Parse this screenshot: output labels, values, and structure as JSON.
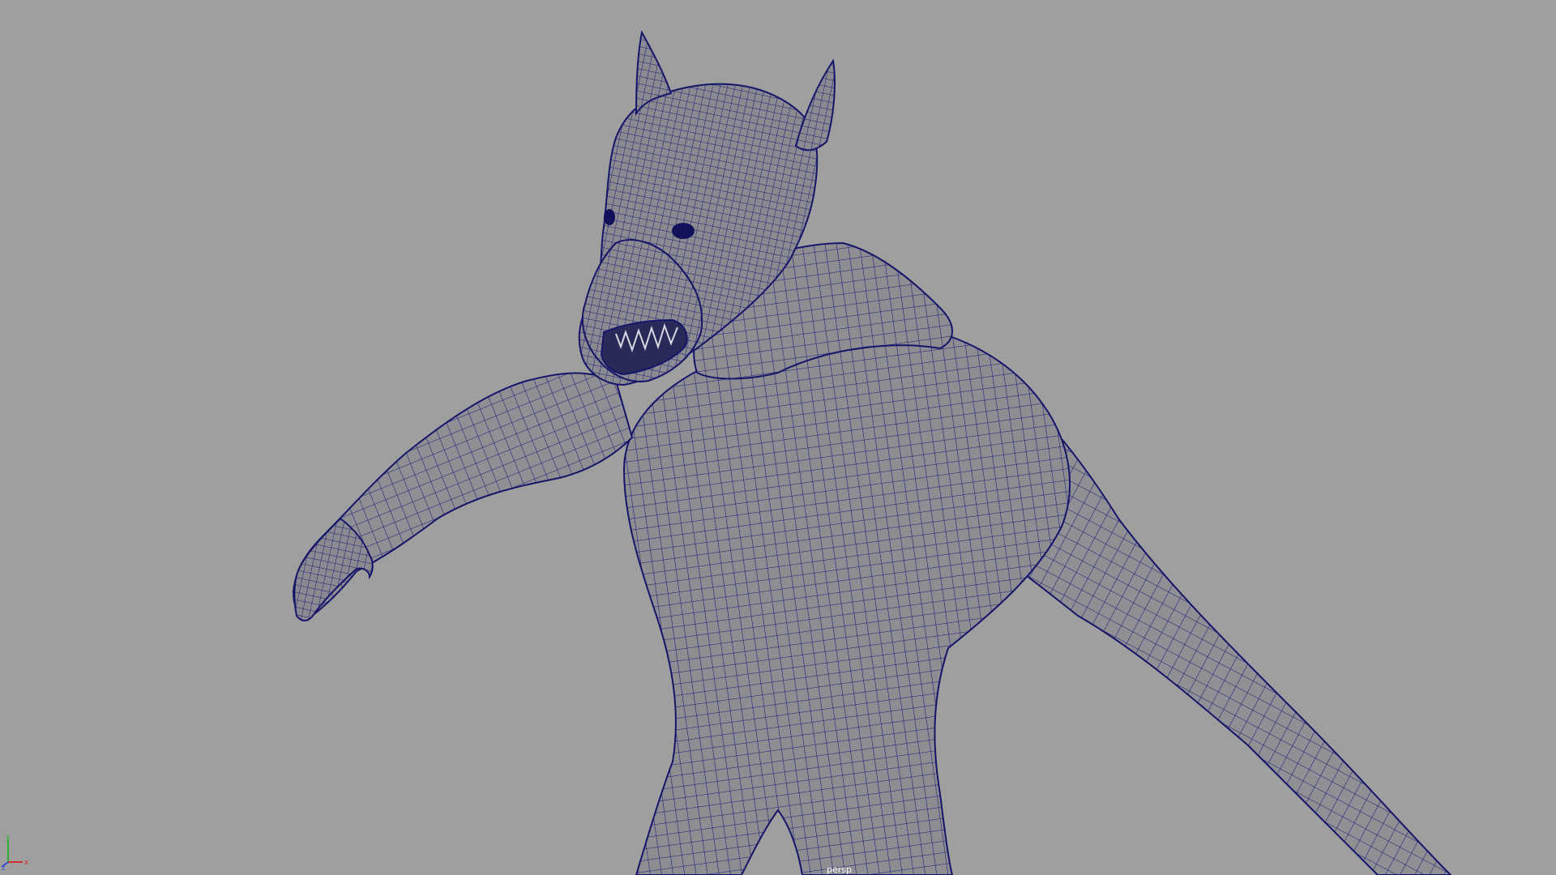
{
  "viewport": {
    "camera_label": "persp",
    "background_color": "#9f9f9f",
    "wireframe_color": "#1a1a7a",
    "shaded_color": "#8e8e93"
  },
  "axis_gizmo": {
    "x_label": "x",
    "y_label": "y",
    "z_label": "z",
    "x_color": "#d03030",
    "y_color": "#30b030",
    "z_color": "#3050d0"
  },
  "scene_object": {
    "name_icon": "werewolf-mesh-icon"
  }
}
